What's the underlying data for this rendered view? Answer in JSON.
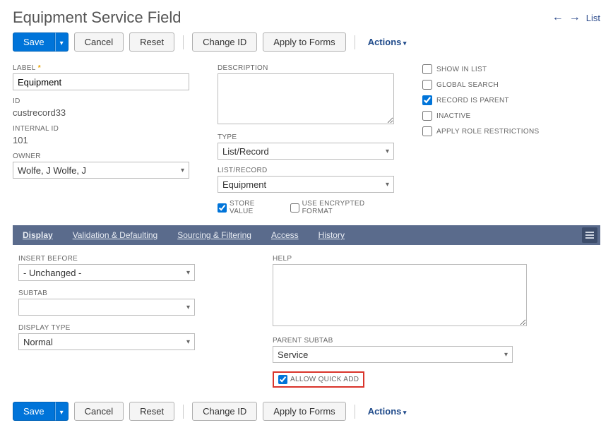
{
  "header": {
    "title": "Equipment Service Field",
    "listLabel": "List"
  },
  "buttons": {
    "save": "Save",
    "cancel": "Cancel",
    "reset": "Reset",
    "changeId": "Change ID",
    "applyToForms": "Apply to Forms",
    "actions": "Actions"
  },
  "fields": {
    "labelLabel": "LABEL",
    "labelValue": "Equipment",
    "idLabel": "ID",
    "idValue": "custrecord33",
    "internalIdLabel": "INTERNAL ID",
    "internalIdValue": "101",
    "ownerLabel": "OWNER",
    "ownerValue": "Wolfe, J Wolfe, J",
    "descriptionLabel": "DESCRIPTION",
    "typeLabel": "TYPE",
    "typeValue": "List/Record",
    "listRecordLabel": "LIST/RECORD",
    "listRecordValue": "Equipment",
    "storeValueLabel": "STORE VALUE",
    "encryptedLabel": "USE ENCRYPTED FORMAT"
  },
  "rightChecks": {
    "showInList": "SHOW IN LIST",
    "globalSearch": "GLOBAL SEARCH",
    "recordIsParent": "RECORD IS PARENT",
    "inactive": "INACTIVE",
    "applyRoleRestrictions": "APPLY ROLE RESTRICTIONS"
  },
  "tabs": {
    "display": "Display",
    "validation": "Validation & Defaulting",
    "sourcing": "Sourcing & Filtering",
    "access": "Access",
    "history": "History"
  },
  "displayTab": {
    "insertBeforeLabel": "INSERT BEFORE",
    "insertBeforeValue": "- Unchanged -",
    "subtabLabel": "SUBTAB",
    "subtabValue": "",
    "displayTypeLabel": "DISPLAY TYPE",
    "displayTypeValue": "Normal",
    "helpLabel": "HELP",
    "parentSubtabLabel": "PARENT SUBTAB",
    "parentSubtabValue": "Service",
    "allowQuickAddLabel": "ALLOW QUICK ADD"
  }
}
